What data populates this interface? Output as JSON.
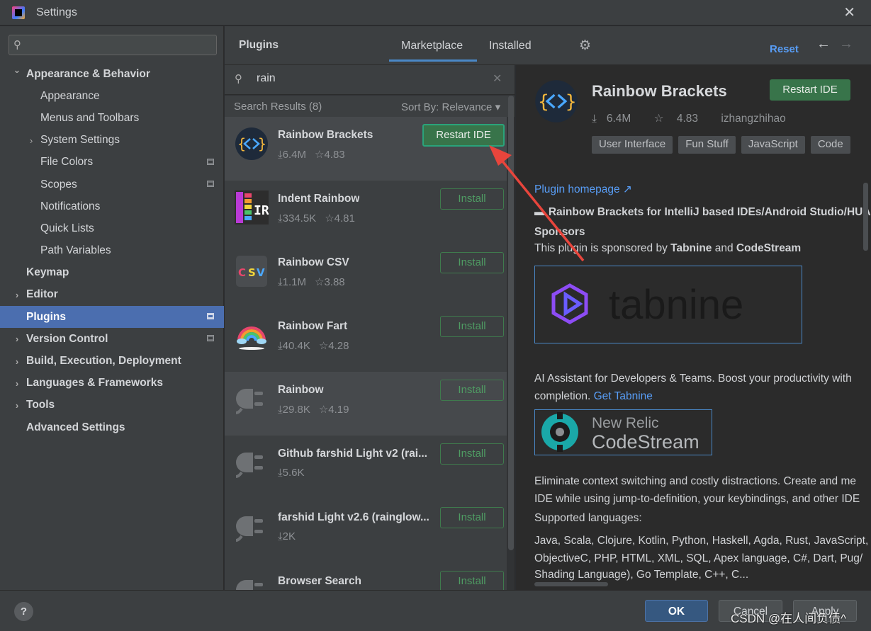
{
  "window": {
    "title": "Settings"
  },
  "sidebar": {
    "search_placeholder": "",
    "items": [
      {
        "label": "Appearance & Behavior",
        "indent": 0,
        "expander": "expanded",
        "bold": true
      },
      {
        "label": "Appearance",
        "indent": 2
      },
      {
        "label": "Menus and Toolbars",
        "indent": 2
      },
      {
        "label": "System Settings",
        "indent": 1,
        "expander": "collapsed"
      },
      {
        "label": "File Colors",
        "indent": 2,
        "badge": true
      },
      {
        "label": "Scopes",
        "indent": 2,
        "badge": true
      },
      {
        "label": "Notifications",
        "indent": 2
      },
      {
        "label": "Quick Lists",
        "indent": 2
      },
      {
        "label": "Path Variables",
        "indent": 2
      },
      {
        "label": "Keymap",
        "indent": 0,
        "bold": true
      },
      {
        "label": "Editor",
        "indent": 0,
        "expander": "collapsed",
        "bold": true
      },
      {
        "label": "Plugins",
        "indent": 0,
        "bold": true,
        "selected": true,
        "badge": true
      },
      {
        "label": "Version Control",
        "indent": 0,
        "expander": "collapsed",
        "bold": true,
        "badge": true
      },
      {
        "label": "Build, Execution, Deployment",
        "indent": 0,
        "expander": "collapsed",
        "bold": true
      },
      {
        "label": "Languages & Frameworks",
        "indent": 0,
        "expander": "collapsed",
        "bold": true
      },
      {
        "label": "Tools",
        "indent": 0,
        "expander": "collapsed",
        "bold": true
      },
      {
        "label": "Advanced Settings",
        "indent": 0,
        "bold": true
      }
    ]
  },
  "plugins_header": {
    "title": "Plugins",
    "tabs": [
      "Marketplace",
      "Installed"
    ],
    "active_tab": "Marketplace",
    "reset_label": "Reset",
    "icons": {
      "settings": "gear-icon",
      "back": "arrow-left-icon",
      "forward": "arrow-right-icon"
    }
  },
  "search": {
    "query": "rain",
    "results_label": "Search Results (8)",
    "sort_label": "Sort By: Relevance"
  },
  "plugins": [
    {
      "name": "Rainbow Brackets",
      "downloads": "6.4M",
      "rating": "4.83",
      "button": "Restart IDE",
      "icon": "rainbow-brackets-icon",
      "highlighted": true
    },
    {
      "name": "Indent Rainbow",
      "downloads": "334.5K",
      "rating": "4.81",
      "button": "Install",
      "icon": "indent-rainbow-icon"
    },
    {
      "name": "Rainbow CSV",
      "downloads": "1.1M",
      "rating": "3.88",
      "button": "Install",
      "icon": "rainbow-csv-icon"
    },
    {
      "name": "Rainbow Fart",
      "downloads": "40.4K",
      "rating": "4.28",
      "button": "Install",
      "icon": "rainbow-fart-icon"
    },
    {
      "name": "Rainbow",
      "downloads": "29.8K",
      "rating": "4.19",
      "button": "Install",
      "icon": "plug-icon",
      "highlighted": true
    },
    {
      "name": "Github farshid Light v2 (rai...",
      "downloads": "5.6K",
      "rating": "",
      "button": "Install",
      "icon": "plug-icon"
    },
    {
      "name": "farshid Light v2.6 (rainglow...",
      "downloads": "2K",
      "rating": "",
      "button": "Install",
      "icon": "plug-icon"
    },
    {
      "name": "Browser Search",
      "downloads": "",
      "rating": "",
      "button": "Install",
      "icon": "plug-icon"
    }
  ],
  "detail": {
    "name": "Rainbow Brackets",
    "restart_label": "Restart IDE",
    "downloads": "6.4M",
    "rating": "4.83",
    "vendor": "izhangzhihao",
    "tags": [
      "User Interface",
      "Fun Stuff",
      "JavaScript",
      "Code"
    ],
    "homepage_label": "Plugin homepage",
    "heading": "Rainbow Brackets for IntelliJ based IDEs/Android Studio/HUA",
    "sponsors_heading": "Sponsors",
    "sponsored_prefix": "This plugin is sponsored by ",
    "sponsor1": "Tabnine",
    "sponsored_and": " and ",
    "sponsor2": "CodeStream",
    "tabnine_logo": "tabnine",
    "ai_text1": "AI Assistant for Developers & Teams. Boost your productivity with",
    "ai_text2": "completion. ",
    "get_tabnine": "Get Tabnine",
    "cs_logo_top": "New Relic",
    "cs_logo_bottom": "CodeStream",
    "elim1": "Eliminate context switching and costly distractions. Create and me",
    "elim2": "IDE while using jump-to-definition, your keybindings, and other IDE",
    "supported": "Supported languages:",
    "langs1": "Java, Scala, Clojure, Kotlin, Python, Haskell, Agda, Rust, JavaScript,",
    "langs2": "ObjectiveC, PHP, HTML, XML, SQL, Apex language, C#, Dart, Pug/",
    "langs3": "Shading Language), Go Template, C++, C..."
  },
  "footer": {
    "help": "?",
    "ok": "OK",
    "cancel": "Cancel",
    "apply": "Apply"
  },
  "watermark": "CSDN @在人间负债^",
  "colors": {
    "accent": "#4b6eaf",
    "link": "#589df6",
    "install_green": "#4f9c63",
    "restart_green": "#38744a",
    "annotation_arrow": "#e8453c"
  }
}
